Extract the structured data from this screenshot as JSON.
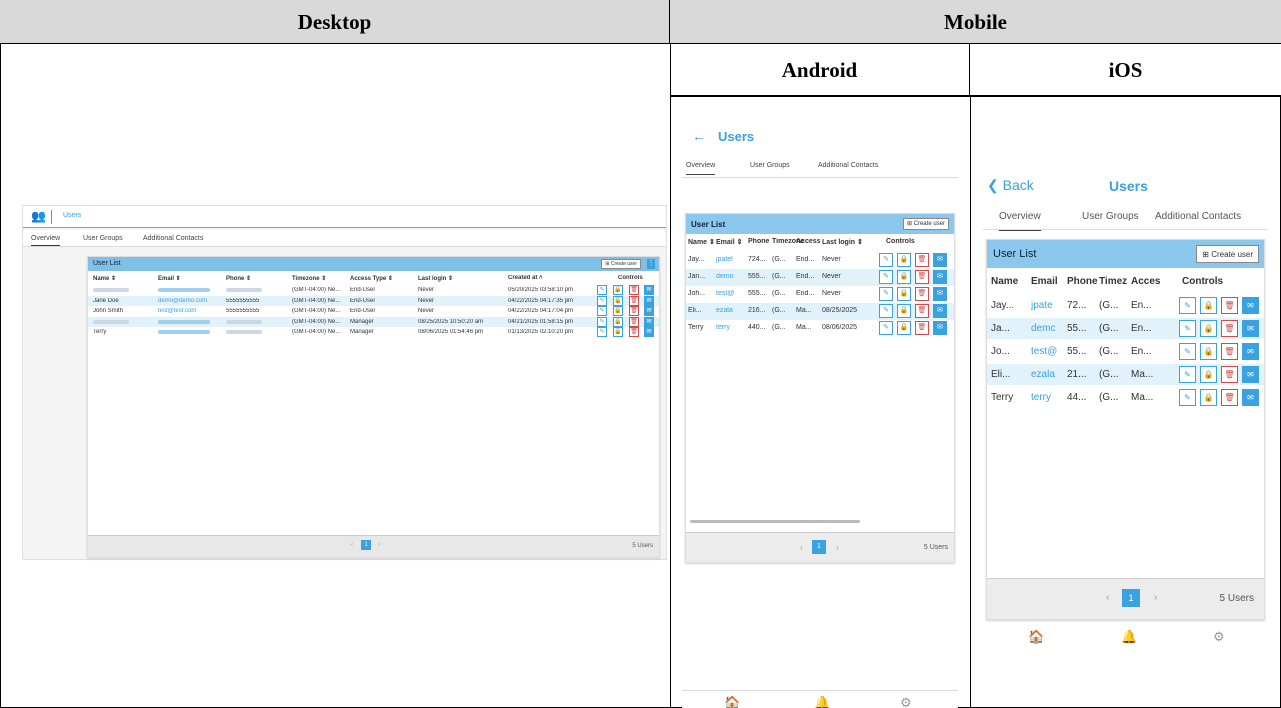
{
  "headers": {
    "desktop": "Desktop",
    "mobile": "Mobile",
    "android": "Android",
    "ios": "iOS"
  },
  "desktop": {
    "app_title": "Users",
    "tabs": [
      "Overview",
      "User Groups",
      "Additional Contacts"
    ],
    "card_title": "User List",
    "create_label": "Create user",
    "kebab": "⋮",
    "columns": [
      "Name ⇕",
      "Email ⇕",
      "Phone ⇕",
      "Timezone ⇕",
      "Access Type ⇕",
      "Last login ⇕",
      "Created at ˄",
      "Controls"
    ],
    "rows": [
      {
        "name": "",
        "email": "",
        "phone": "",
        "timezone": "(GMT-04:00) Ne...",
        "access": "End-User",
        "last_login": "Never",
        "created": "05/20/2025 03:58:10 pm"
      },
      {
        "name": "Jane Doe",
        "email": "demo@demo.com",
        "phone": "5555555555",
        "timezone": "(GMT-04:00) Ne...",
        "access": "End-User",
        "last_login": "Never",
        "created": "04/22/2025 04:17:35 pm"
      },
      {
        "name": "John Smith",
        "email": "test@test.com",
        "phone": "5555555555",
        "timezone": "(GMT-04:00) Ne...",
        "access": "End-User",
        "last_login": "Never",
        "created": "04/22/2025 04:17:04 pm"
      },
      {
        "name": "",
        "email": "",
        "phone": "",
        "timezone": "(GMT-04:00) Ne...",
        "access": "Manager",
        "last_login": "08/25/2025 10:50:20 am",
        "created": "04/21/2025 01:58:15 pm"
      },
      {
        "name": "Terry",
        "email": "",
        "phone": "",
        "timezone": "(GMT-04:00) Ne...",
        "access": "Manager",
        "last_login": "08/06/2025 01:54:46 pm",
        "created": "01/13/2025 02:10:20 pm"
      }
    ],
    "page_prev": "‹",
    "page_current": "1",
    "page_next": "›",
    "count": "5 Users"
  },
  "android": {
    "back_icon": "←",
    "title": "Users",
    "tabs": [
      "Overview",
      "User Groups",
      "Additional Contacts"
    ],
    "card_title": "User List",
    "create_label": "Create user",
    "columns": [
      "Name ⇕",
      "Email ⇕",
      "Phone",
      "Timezone",
      "Access",
      "Last login ⇕",
      "Controls"
    ],
    "rows": [
      {
        "name": "Jay...",
        "email": "jpatel",
        "phone": "724...",
        "tz": "(G...",
        "access": "End...",
        "login": "Never"
      },
      {
        "name": "Jan...",
        "email": "demo",
        "phone": "555...",
        "tz": "(G...",
        "access": "End...",
        "login": "Never"
      },
      {
        "name": "Joh...",
        "email": "test@",
        "phone": "555...",
        "tz": "(G...",
        "access": "End...",
        "login": "Never"
      },
      {
        "name": "Eli...",
        "email": "ezala",
        "phone": "216...",
        "tz": "(G...",
        "access": "Ma...",
        "login": "08/25/2025"
      },
      {
        "name": "Terry",
        "email": "terry",
        "phone": "440...",
        "tz": "(G...",
        "access": "Ma...",
        "login": "08/06/2025"
      }
    ],
    "page_prev": "‹",
    "page_current": "1",
    "page_next": "›",
    "count": "5 Users"
  },
  "ios": {
    "back_label": "❮ Back",
    "title": "Users",
    "tabs": [
      "Overview",
      "User Groups",
      "Additional Contacts"
    ],
    "card_title": "User List",
    "create_label": "Create user",
    "columns": [
      "Name",
      "Email",
      "Phone",
      "Timez",
      "Acces",
      "Controls"
    ],
    "rows": [
      {
        "name": "Jay...",
        "email": "jpate",
        "phone": "72...",
        "tz": "(G...",
        "access": "En..."
      },
      {
        "name": "Ja...",
        "email": "demc",
        "phone": "55...",
        "tz": "(G...",
        "access": "En..."
      },
      {
        "name": "Jo...",
        "email": "test@",
        "phone": "55...",
        "tz": "(G...",
        "access": "En..."
      },
      {
        "name": "Eli...",
        "email": "ezala",
        "phone": "21...",
        "tz": "(G...",
        "access": "Ma..."
      },
      {
        "name": "Terry",
        "email": "terry",
        "phone": "44...",
        "tz": "(G...",
        "access": "Ma..."
      }
    ],
    "page_prev": "‹",
    "page_current": "1",
    "page_next": "›",
    "count": "5 Users"
  },
  "icons": {
    "home": "🏠",
    "bell": "🔔",
    "gear": "⚙",
    "edit": "✎",
    "lock": "🔒",
    "delete": "🗑",
    "mail": "✉",
    "plus_box": "⊞"
  },
  "colors": {
    "accent": "#3aa2e0",
    "header_bar": "#7fbfe8",
    "row_highlight": "#e2f2fb",
    "delete": "#d24b4b"
  }
}
